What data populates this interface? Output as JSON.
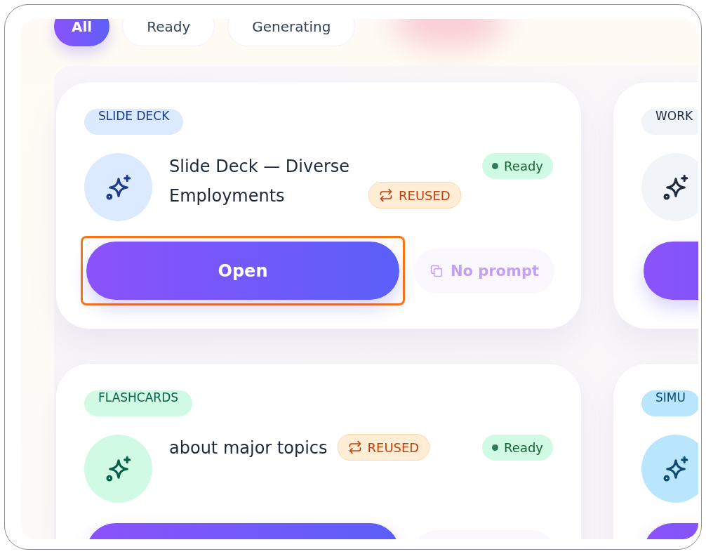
{
  "filters": [
    {
      "label": "All",
      "selected": true
    },
    {
      "label": "Ready",
      "selected": false
    },
    {
      "label": "Generating",
      "selected": false
    }
  ],
  "cards": [
    {
      "tag": "SLIDE DECK",
      "color": "#dbeafe",
      "title": "Slide Deck — Diverse Employments",
      "reused": true,
      "reused_label": "REUSED",
      "status": "Ready",
      "open_label": "Open",
      "highlighted": true,
      "secondary_label": "No prompt"
    },
    {
      "tag": "WORK",
      "color": "#f1f5f9"
    },
    {
      "tag": "FLASHCARDS",
      "color": "#d1fae5",
      "title": "about major topics",
      "reused": true,
      "reused_label": "REUSED",
      "status": "Ready",
      "highlighted": false
    },
    {
      "tag": "SIMU",
      "color": "#bae6fd"
    }
  ]
}
